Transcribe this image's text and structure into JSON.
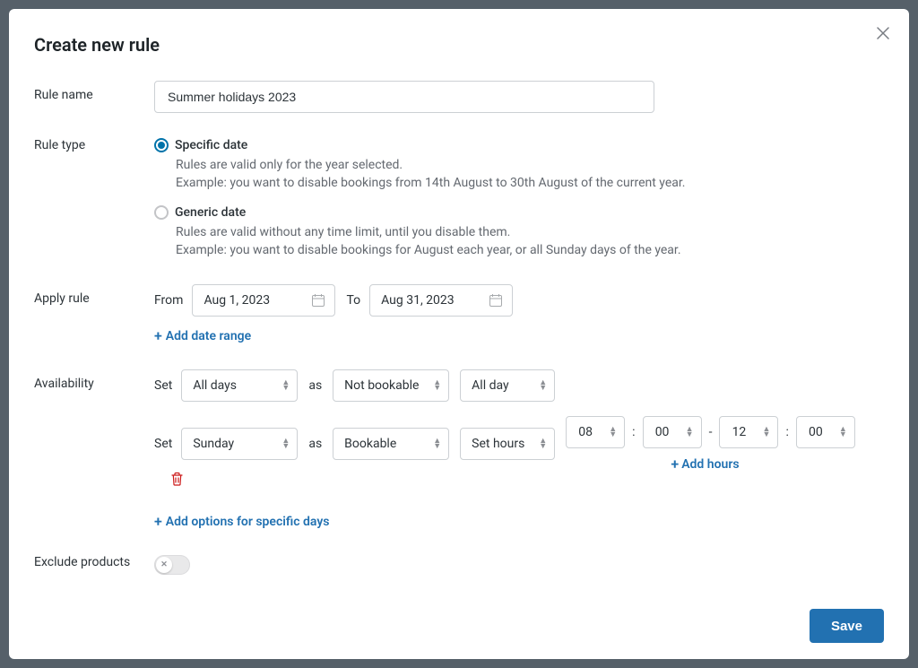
{
  "modal": {
    "title": "Create new rule",
    "close_label": "Close"
  },
  "rule_name": {
    "label": "Rule name",
    "value": "Summer holidays 2023"
  },
  "rule_type": {
    "label": "Rule type",
    "options": [
      {
        "id": "specific",
        "title": "Specific date",
        "desc_line1": "Rules are valid only for the year selected.",
        "desc_line2": "Example: you want to disable bookings from 14th August to 30th August of the current year.",
        "selected": true
      },
      {
        "id": "generic",
        "title": "Generic date",
        "desc_line1": "Rules are valid without any time limit, until you disable them.",
        "desc_line2": "Example: you want to disable bookings for August each year, or all Sunday days of the year.",
        "selected": false
      }
    ]
  },
  "apply_rule": {
    "label": "Apply rule",
    "from_label": "From",
    "from_value": "Aug 1, 2023",
    "to_label": "To",
    "to_value": "Aug 31, 2023",
    "add_range_label": "Add date range"
  },
  "availability": {
    "label": "Availability",
    "set_label": "Set",
    "as_label": "as",
    "rows": [
      {
        "day_scope": "All days",
        "bookable": "Not bookable",
        "hours_mode": "All day"
      },
      {
        "day_scope": "Sunday",
        "bookable": "Bookable",
        "hours_mode": "Set hours",
        "from_h": "08",
        "from_m": "00",
        "to_h": "12",
        "to_m": "00"
      }
    ],
    "add_hours_label": "Add hours",
    "add_options_label": "Add options for specific days"
  },
  "exclude_products": {
    "label": "Exclude products",
    "enabled": false
  },
  "footer": {
    "save_label": "Save"
  }
}
